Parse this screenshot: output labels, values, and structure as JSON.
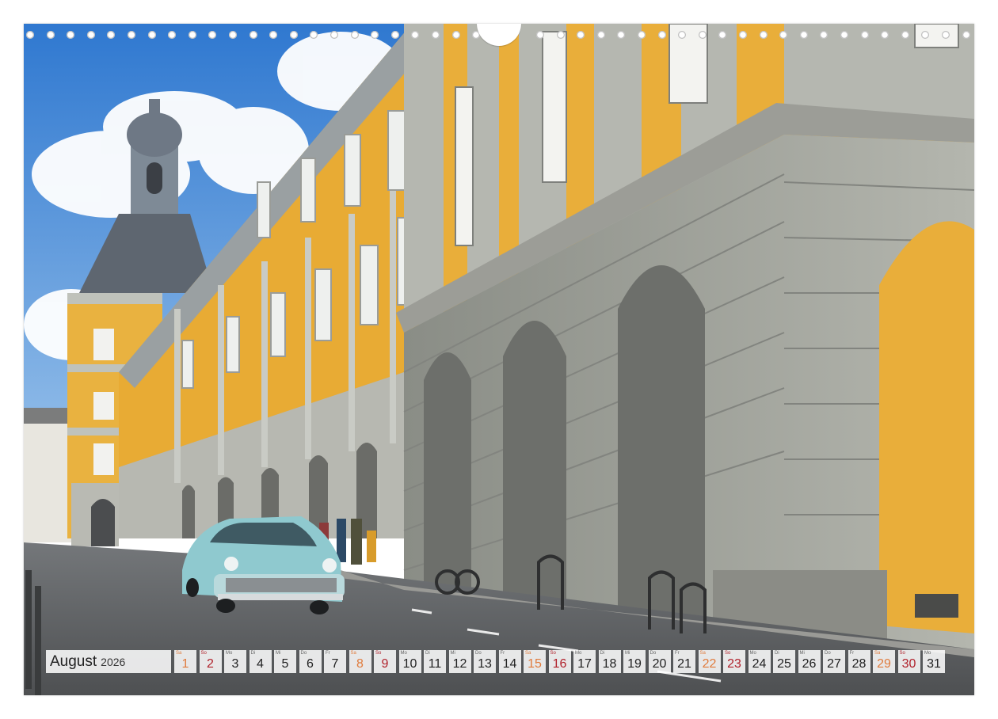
{
  "calendar": {
    "month": "August",
    "year": "2026",
    "colors": {
      "saturday": "#e07b3c",
      "sunday": "#b0202a"
    },
    "days": [
      {
        "wd": "Sa",
        "num": "1",
        "type": "sat"
      },
      {
        "wd": "So",
        "num": "2",
        "type": "sun"
      },
      {
        "wd": "Mo",
        "num": "3",
        "type": "wk"
      },
      {
        "wd": "Di",
        "num": "4",
        "type": "wk"
      },
      {
        "wd": "Mi",
        "num": "5",
        "type": "wk"
      },
      {
        "wd": "Do",
        "num": "6",
        "type": "wk"
      },
      {
        "wd": "Fr",
        "num": "7",
        "type": "wk"
      },
      {
        "wd": "Sa",
        "num": "8",
        "type": "sat"
      },
      {
        "wd": "So",
        "num": "9",
        "type": "sun"
      },
      {
        "wd": "Mo",
        "num": "10",
        "type": "wk"
      },
      {
        "wd": "Di",
        "num": "11",
        "type": "wk"
      },
      {
        "wd": "Mi",
        "num": "12",
        "type": "wk"
      },
      {
        "wd": "Do",
        "num": "13",
        "type": "wk"
      },
      {
        "wd": "Fr",
        "num": "14",
        "type": "wk"
      },
      {
        "wd": "Sa",
        "num": "15",
        "type": "sat"
      },
      {
        "wd": "So",
        "num": "16",
        "type": "sun"
      },
      {
        "wd": "Mo",
        "num": "17",
        "type": "wk"
      },
      {
        "wd": "Di",
        "num": "18",
        "type": "wk"
      },
      {
        "wd": "Mi",
        "num": "19",
        "type": "wk"
      },
      {
        "wd": "Do",
        "num": "20",
        "type": "wk"
      },
      {
        "wd": "Fr",
        "num": "21",
        "type": "wk"
      },
      {
        "wd": "Sa",
        "num": "22",
        "type": "sat"
      },
      {
        "wd": "So",
        "num": "23",
        "type": "sun"
      },
      {
        "wd": "Mo",
        "num": "24",
        "type": "wk"
      },
      {
        "wd": "Di",
        "num": "25",
        "type": "wk"
      },
      {
        "wd": "Mi",
        "num": "26",
        "type": "wk"
      },
      {
        "wd": "Do",
        "num": "27",
        "type": "wk"
      },
      {
        "wd": "Fr",
        "num": "28",
        "type": "wk"
      },
      {
        "wd": "Sa",
        "num": "29",
        "type": "sat"
      },
      {
        "wd": "So",
        "num": "30",
        "type": "sun"
      },
      {
        "wd": "Mo",
        "num": "31",
        "type": "wk"
      }
    ]
  },
  "photo": {
    "subject": "street-scene-baroque-palace-vintage-car",
    "colors": {
      "sky": "#3f86d8",
      "facade_yellow": "#eeb13a",
      "stone_grey": "#a9aba2",
      "road": "#5d5f5f",
      "car": "#8fc9cf"
    }
  }
}
